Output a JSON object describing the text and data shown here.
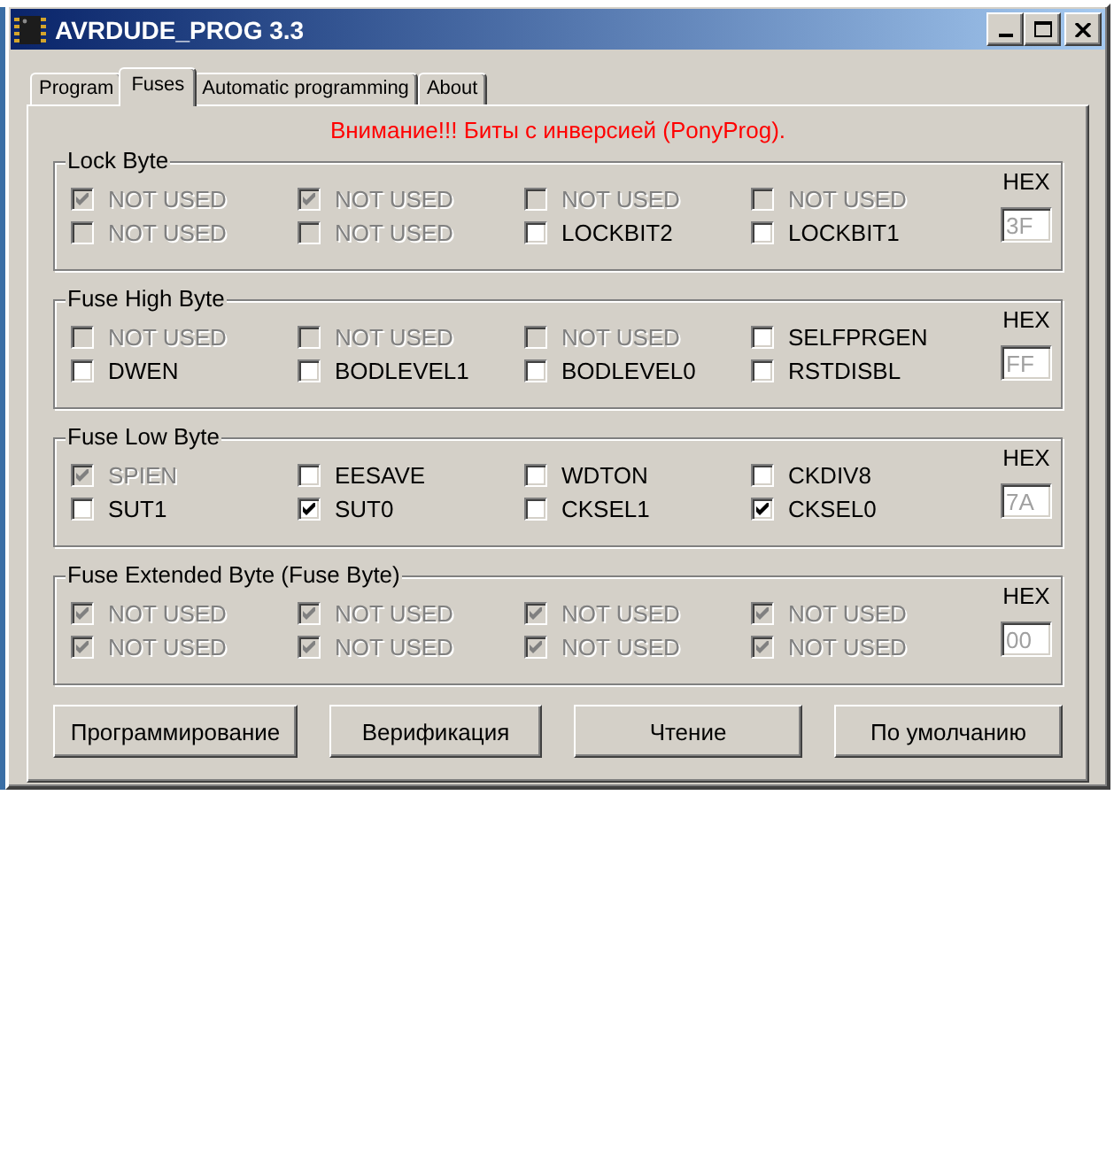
{
  "window": {
    "title": "AVRDUDE_PROG 3.3"
  },
  "tabs": [
    {
      "label": "Program",
      "selected": false
    },
    {
      "label": "Fuses",
      "selected": true
    },
    {
      "label": "Automatic programming",
      "selected": false
    },
    {
      "label": "About",
      "selected": false
    }
  ],
  "warning": "Внимание!!! Биты с инверсией (PonyProg).",
  "groups": [
    {
      "title": "Lock Byte",
      "hex_label": "HEX",
      "hex": {
        "value": "3F",
        "disabled": true
      },
      "bits": [
        {
          "label": "NOT USED",
          "checked": true,
          "disabled": true
        },
        {
          "label": "NOT USED",
          "checked": true,
          "disabled": true
        },
        {
          "label": "NOT USED",
          "checked": false,
          "disabled": true
        },
        {
          "label": "NOT USED",
          "checked": false,
          "disabled": true
        },
        {
          "label": "NOT USED",
          "checked": false,
          "disabled": true
        },
        {
          "label": "NOT USED",
          "checked": false,
          "disabled": true
        },
        {
          "label": "LOCKBIT2",
          "checked": false,
          "disabled": false
        },
        {
          "label": "LOCKBIT1",
          "checked": false,
          "disabled": false
        }
      ]
    },
    {
      "title": "Fuse High Byte",
      "hex_label": "HEX",
      "hex": {
        "value": "FF",
        "disabled": true
      },
      "bits": [
        {
          "label": "NOT USED",
          "checked": false,
          "disabled": true
        },
        {
          "label": "NOT USED",
          "checked": false,
          "disabled": true
        },
        {
          "label": "NOT USED",
          "checked": false,
          "disabled": true
        },
        {
          "label": "SELFPRGEN",
          "checked": false,
          "disabled": false
        },
        {
          "label": "DWEN",
          "checked": false,
          "disabled": false
        },
        {
          "label": "BODLEVEL1",
          "checked": false,
          "disabled": false
        },
        {
          "label": "BODLEVEL0",
          "checked": false,
          "disabled": false
        },
        {
          "label": "RSTDISBL",
          "checked": false,
          "disabled": false
        }
      ]
    },
    {
      "title": "Fuse Low Byte",
      "hex_label": "HEX",
      "hex": {
        "value": "7A",
        "disabled": true
      },
      "bits": [
        {
          "label": "SPIEN",
          "checked": true,
          "disabled": true
        },
        {
          "label": "EESAVE",
          "checked": false,
          "disabled": false
        },
        {
          "label": "WDTON",
          "checked": false,
          "disabled": false
        },
        {
          "label": "CKDIV8",
          "checked": false,
          "disabled": false
        },
        {
          "label": "SUT1",
          "checked": false,
          "disabled": false
        },
        {
          "label": "SUT0",
          "checked": true,
          "disabled": false
        },
        {
          "label": "CKSEL1",
          "checked": false,
          "disabled": false
        },
        {
          "label": "CKSEL0",
          "checked": true,
          "disabled": false
        }
      ]
    },
    {
      "title": "Fuse Extended Byte (Fuse Byte)",
      "hex_label": "HEX",
      "hex": {
        "value": "00",
        "disabled": true
      },
      "bits": [
        {
          "label": "NOT USED",
          "checked": true,
          "disabled": true
        },
        {
          "label": "NOT USED",
          "checked": true,
          "disabled": true
        },
        {
          "label": "NOT USED",
          "checked": true,
          "disabled": true
        },
        {
          "label": "NOT USED",
          "checked": true,
          "disabled": true
        },
        {
          "label": "NOT USED",
          "checked": true,
          "disabled": true
        },
        {
          "label": "NOT USED",
          "checked": true,
          "disabled": true
        },
        {
          "label": "NOT USED",
          "checked": true,
          "disabled": true
        },
        {
          "label": "NOT USED",
          "checked": true,
          "disabled": true
        }
      ]
    }
  ],
  "buttons": [
    "Программирование",
    "Верификация",
    "Чтение",
    "По умолчанию"
  ]
}
